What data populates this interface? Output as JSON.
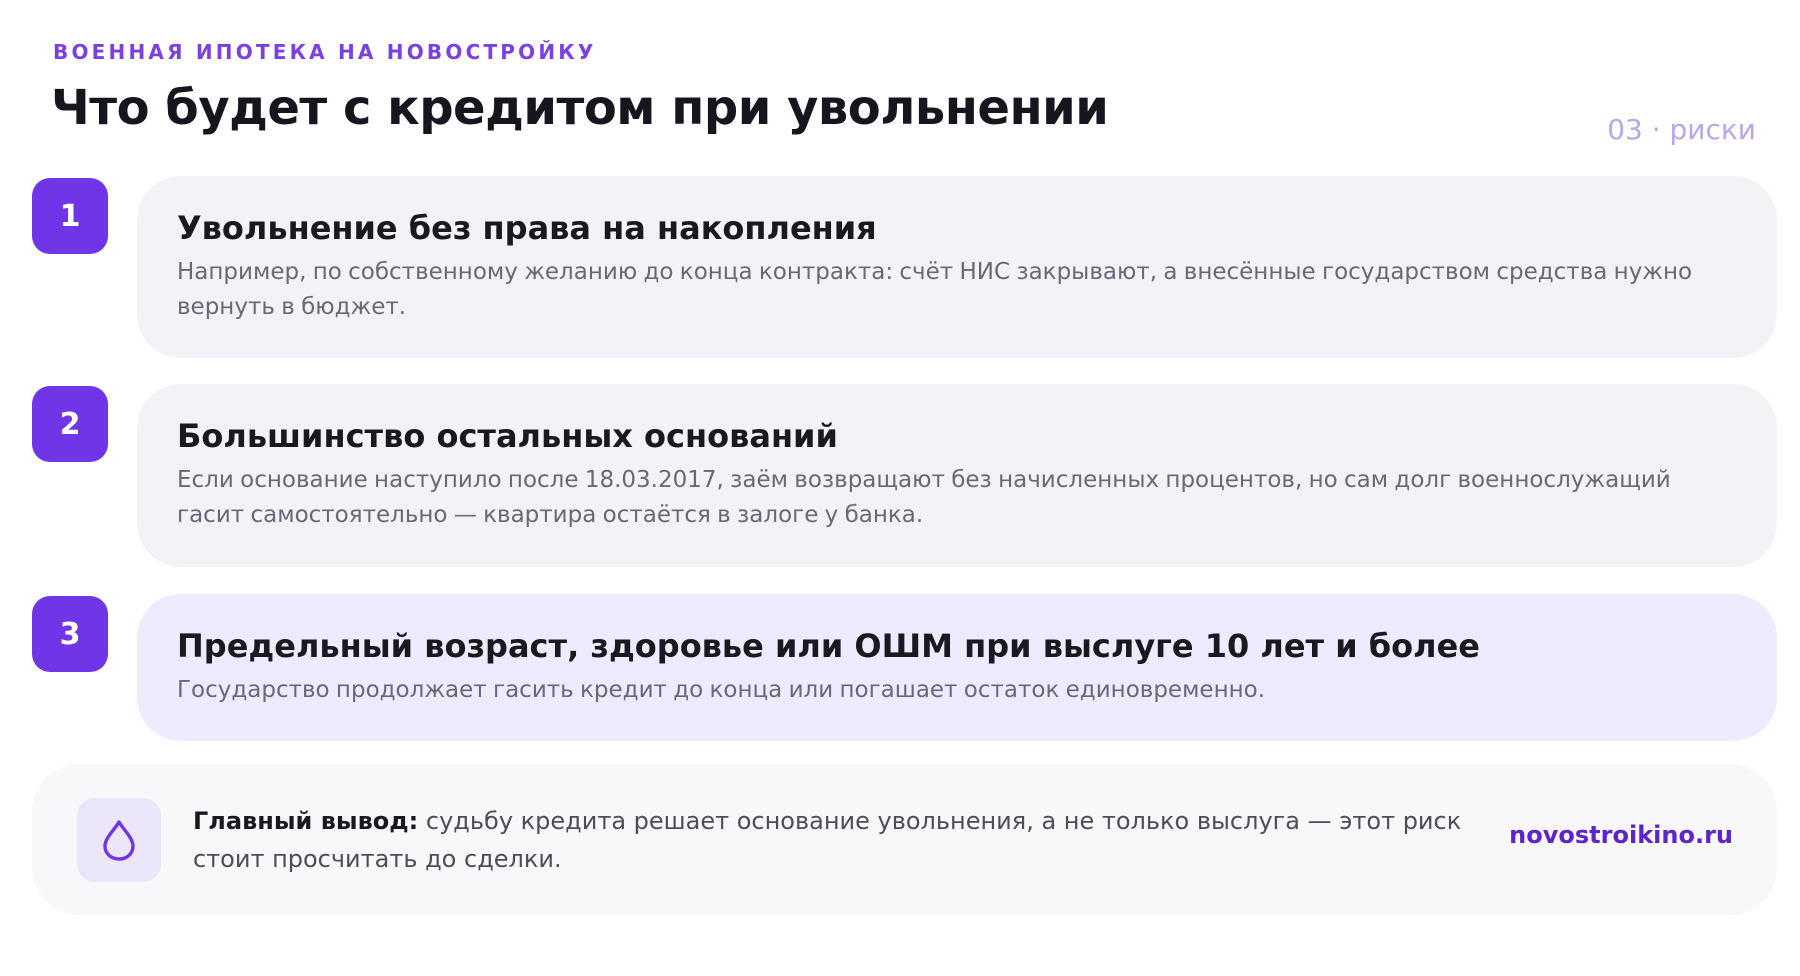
{
  "header": {
    "eyebrow": "ВОЕННАЯ ИПОТЕКА НА НОВОСТРОЙКУ",
    "title": "Что будет с кредитом при увольнении",
    "section_tag": "03 · риски"
  },
  "steps": [
    {
      "number": "1",
      "title": "Увольнение без права на накопления",
      "text": "Например, по собственному желанию до конца контракта: счёт НИС закрывают, а внесённые государством средства нужно вернуть в бюджет."
    },
    {
      "number": "2",
      "title": "Большинство остальных оснований",
      "text": "Если основание наступило после 18.03.2017, заём возвращают без начисленных процентов, но сам долг военнослужащий гасит самостоятельно — квартира остаётся в залоге у банка."
    },
    {
      "number": "3",
      "title": "Предельный возраст, здоровье или ОШМ при выслуге 10 лет и более",
      "text": "Государство продолжает гасить кредит до конца или погашает остаток единовременно."
    }
  ],
  "summary": {
    "icon": "drop-icon",
    "label": "Главный вывод:",
    "text": " судьбу кредита решает основание увольнения, а не только выслуга — этот риск стоит просчитать до сделки.",
    "site": "novostroikino.ru"
  },
  "colors": {
    "accent": "#6f35e6",
    "eyebrow": "#7b3fe4",
    "card": "#f3f2f6",
    "card_highlight": "#efeafd",
    "link": "#5b25c9"
  }
}
